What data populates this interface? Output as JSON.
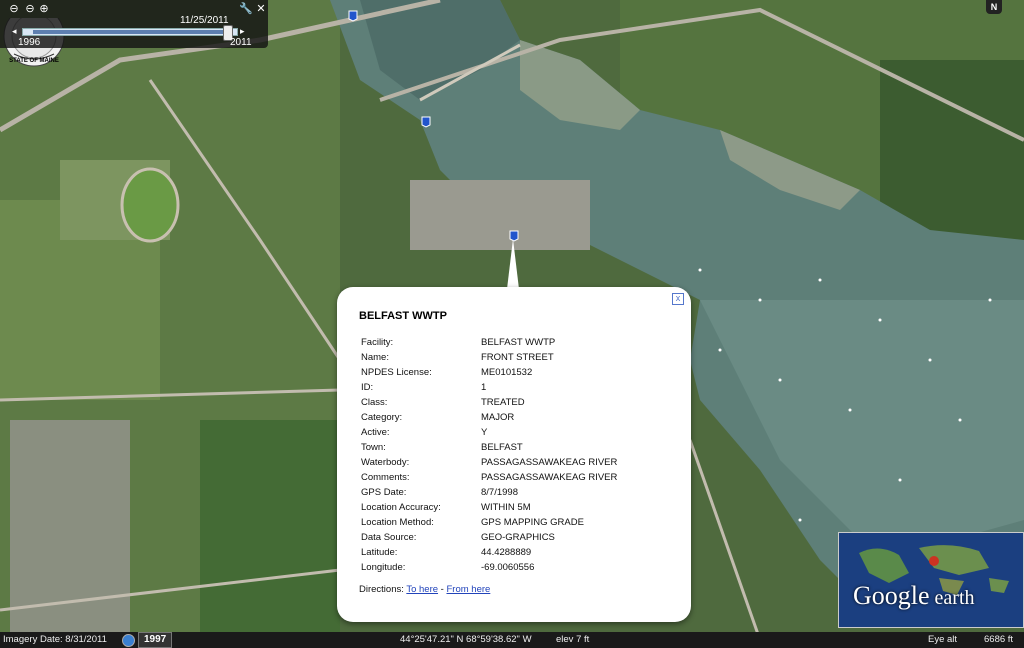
{
  "time_slider": {
    "current_date": "11/25/2011",
    "start_year": "1996",
    "end_year": "2011"
  },
  "north_label": "N",
  "popup": {
    "title": "BELFAST WWTP",
    "fields": [
      {
        "label": "Facility:",
        "value": "BELFAST WWTP"
      },
      {
        "label": "Name:",
        "value": "FRONT STREET"
      },
      {
        "label": "NPDES License:",
        "value": "ME0101532"
      },
      {
        "label": "ID:",
        "value": "1"
      },
      {
        "label": "Class:",
        "value": "TREATED"
      },
      {
        "label": "Category:",
        "value": "MAJOR"
      },
      {
        "label": "Active:",
        "value": "Y"
      },
      {
        "label": "Town:",
        "value": "BELFAST"
      },
      {
        "label": "Waterbody:",
        "value": "PASSAGASSAWAKEAG RIVER"
      },
      {
        "label": "Comments:",
        "value": "PASSAGASSAWAKEAG RIVER"
      },
      {
        "label": "GPS Date:",
        "value": "8/7/1998"
      },
      {
        "label": "Location Accuracy:",
        "value": "WITHIN 5M"
      },
      {
        "label": "Location Method:",
        "value": "GPS MAPPING GRADE"
      },
      {
        "label": "Data Source:",
        "value": "GEO-GRAPHICS"
      },
      {
        "label": "Latitude:",
        "value": "44.4288889"
      },
      {
        "label": "Longitude:",
        "value": "-69.0060556"
      }
    ],
    "directions_label": "Directions:",
    "to_here": "To here",
    "separator": " - ",
    "from_here": "From here",
    "close_glyph": "x"
  },
  "logo": {
    "google": "Google",
    "earth": " earth"
  },
  "status_bar": {
    "imagery_date": "Imagery Date: 8/31/2011",
    "year": "1997",
    "coordinates": "44°25'47.21\" N   68°59'38.62\" W",
    "elev": "elev   7 ft",
    "eye_alt_label": "Eye alt",
    "eye_alt_value": "6686 ft"
  },
  "icons": {
    "time_slider_tools": [
      "zoom-out-icon",
      "zoom-in-icon",
      "wrench-icon",
      "close-icon"
    ],
    "pins": "blue-placemark-icon"
  }
}
